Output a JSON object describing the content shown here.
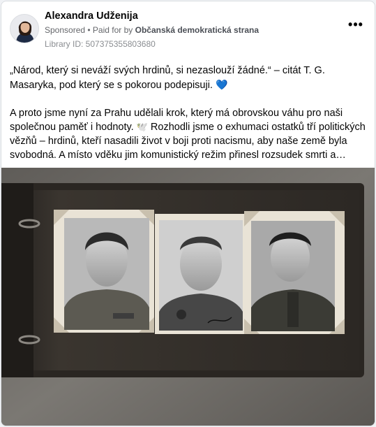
{
  "post": {
    "author": "Alexandra Udženija",
    "sponsored": "Sponsored",
    "paid_for_prefix": "• Paid for by ",
    "payer": "Občanská demokratická strana",
    "library_id": "Library ID: 507375355803680",
    "more_icon": "more-options-icon",
    "paragraph1": "„Národ, který si neváží svých hrdinů, si nezaslouží žádné.“ – citát T. G. Masaryka, pod který se s pokorou podepisuji. ",
    "paragraph2_a": "A proto jsme nyní za Prahu udělali krok, který má obrovskou váhu pro naši společnou paměť i hodnoty. ",
    "paragraph2_b": " Rozhodli jsme o exhumaci ostatků tří politických vězňů – hrdinů, kteří nasadili život v boji proti nacismu, aby naše země byla svobodná. A místo vděku jim komunistický režim přinesl rozsudek smrti a…"
  },
  "icons": {
    "heart": "blue-heart-icon",
    "dove": "dove-icon"
  },
  "colors": {
    "card_bg": "#ffffff",
    "text": "#050505",
    "muted": "#65676b",
    "heart": "#4a8fe7",
    "album_bg": "#6e6b66"
  }
}
